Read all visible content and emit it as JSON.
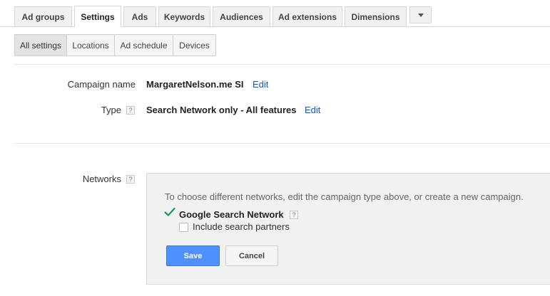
{
  "tabs": [
    {
      "label": "Ad groups",
      "active": false
    },
    {
      "label": "Settings",
      "active": true
    },
    {
      "label": "Ads",
      "active": false
    },
    {
      "label": "Keywords",
      "active": false
    },
    {
      "label": "Audiences",
      "active": false
    },
    {
      "label": "Ad extensions",
      "active": false
    },
    {
      "label": "Dimensions",
      "active": false
    }
  ],
  "more_icon": "chevron-down-icon",
  "subtabs": [
    {
      "label": "All settings",
      "active": true
    },
    {
      "label": "Locations",
      "active": false
    },
    {
      "label": "Ad schedule",
      "active": false
    },
    {
      "label": "Devices",
      "active": false
    }
  ],
  "campaign": {
    "name_label": "Campaign name",
    "name_value": "MargaretNelson.me SI",
    "name_edit": "Edit",
    "type_label": "Type",
    "type_value": "Search Network only - All features",
    "type_edit": "Edit",
    "help_glyph": "?"
  },
  "networks": {
    "label": "Networks",
    "note": "To choose different networks, edit the campaign type above, or create a new campaign.",
    "google_search_network": "Google Search Network",
    "google_search_checked": true,
    "include_partners_label": "Include search partners",
    "include_partners_checked": false,
    "save_label": "Save",
    "cancel_label": "Cancel"
  },
  "colors": {
    "accent": "#4d90fe",
    "link": "#1155cc",
    "check": "#0f9d58"
  }
}
